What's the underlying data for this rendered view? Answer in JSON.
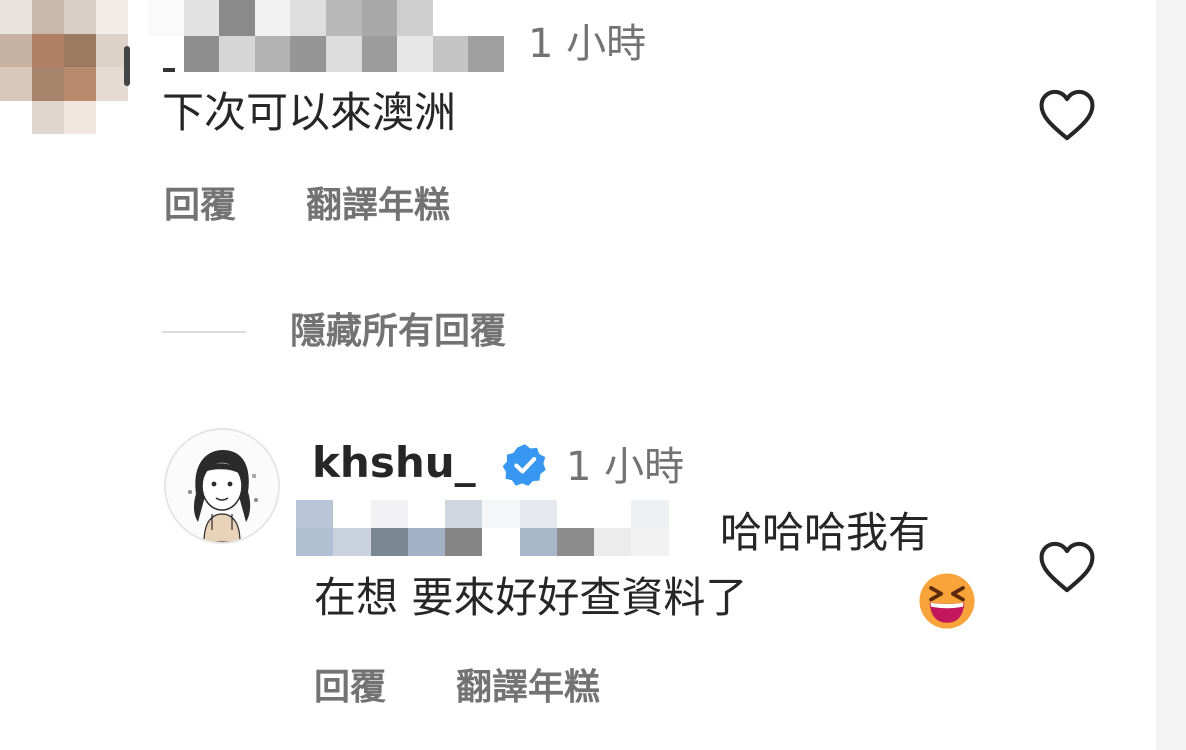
{
  "comment1": {
    "timestamp": "1 小時",
    "text": "下次可以來澳洲",
    "reply_label": "回覆",
    "translate_label": "翻譯年糕"
  },
  "hide_replies_label": "隱藏所有回覆",
  "reply": {
    "username": "khshu_",
    "verified": true,
    "timestamp": "1 小時",
    "text_line1": "哈哈哈我有",
    "text_line2": "在想 要來好好查資料了",
    "emoji": "grinning-squinting-face",
    "reply_label": "回覆",
    "translate_label": "翻譯年糕"
  },
  "colors": {
    "text_primary": "#262626",
    "text_secondary": "#737373",
    "verified_blue": "#3897f0",
    "divider": "#dbdbdb"
  },
  "icons": {
    "like": "heart-outline-icon",
    "verified": "verified-badge-icon"
  }
}
